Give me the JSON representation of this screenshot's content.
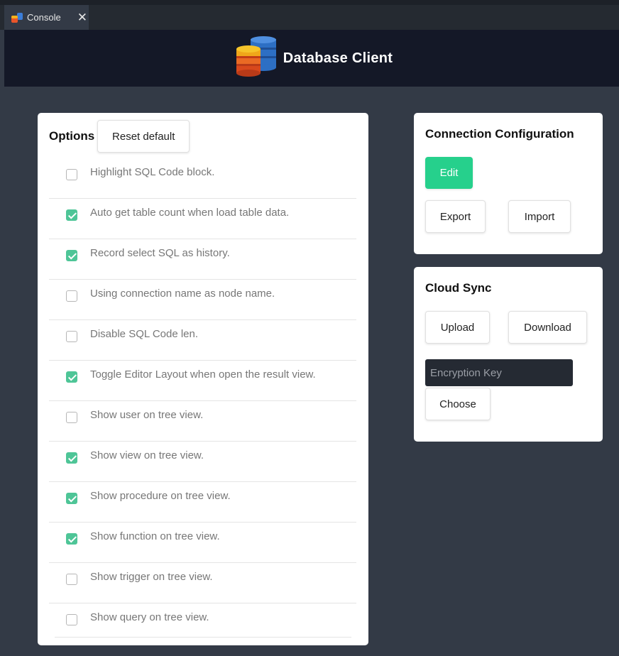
{
  "tab": {
    "label": "Console",
    "close_glyph": "✕",
    "icon": "database-icon"
  },
  "header": {
    "title": "Database Client",
    "logo": "database-stack-logo"
  },
  "options": {
    "title": "Options",
    "reset_label": "Reset default",
    "items": [
      {
        "label": "Highlight SQL Code block.",
        "checked": false
      },
      {
        "label": "Auto get table count when load table data.",
        "checked": true
      },
      {
        "label": "Record select SQL as history.",
        "checked": true
      },
      {
        "label": "Using connection name as node name.",
        "checked": false
      },
      {
        "label": "Disable SQL Code len.",
        "checked": false
      },
      {
        "label": "Toggle Editor Layout when open the result view.",
        "checked": true
      },
      {
        "label": "Show user on tree view.",
        "checked": false
      },
      {
        "label": "Show view on tree view.",
        "checked": true
      },
      {
        "label": "Show procedure on tree view.",
        "checked": true
      },
      {
        "label": "Show function on tree view.",
        "checked": true
      },
      {
        "label": "Show trigger on tree view.",
        "checked": false
      },
      {
        "label": "Show query on tree view.",
        "checked": false
      }
    ]
  },
  "connection": {
    "title": "Connection Configuration",
    "edit_label": "Edit",
    "export_label": "Export",
    "import_label": "Import"
  },
  "sync": {
    "title": "Cloud Sync",
    "upload_label": "Upload",
    "download_label": "Download",
    "key_placeholder": "Encryption Key",
    "choose_label": "Choose"
  },
  "colors": {
    "accent": "#26d08c",
    "checkbox": "#4ec597",
    "background": "#333a46",
    "header": "#141827"
  }
}
